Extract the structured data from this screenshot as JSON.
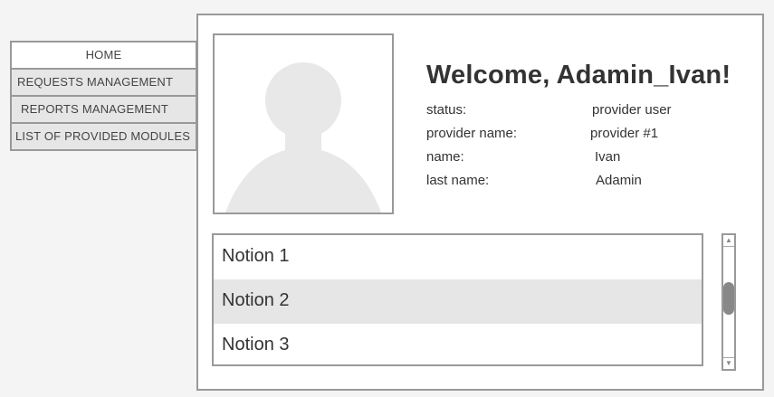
{
  "nav": {
    "items": [
      {
        "label": "HOME",
        "active": true
      },
      {
        "label": "REQUESTS MANAGEMENT",
        "active": false
      },
      {
        "label": "REPORTS MANAGEMENT",
        "active": false
      },
      {
        "label": "LIST OF PROVIDED MODULES",
        "active": false
      }
    ]
  },
  "profile": {
    "welcome": "Welcome, Adamin_Ivan!",
    "fields": [
      {
        "label": "status:",
        "value": "provider user"
      },
      {
        "label": "provider name:",
        "value": "provider #1"
      },
      {
        "label": "name:",
        "value": "Ivan"
      },
      {
        "label": "last name:",
        "value": "Adamin"
      }
    ],
    "avatar_icon": "user-placeholder-icon"
  },
  "notions": {
    "items": [
      "Notion 1",
      "Notion 2",
      "Notion 3"
    ],
    "selected_index": 1
  },
  "scrollbar": {
    "position": 0.45,
    "up_glyph": "▲",
    "down_glyph": "▼"
  },
  "colors": {
    "border": "#999999",
    "selected_bg": "#e6e6e6",
    "page_bg": "#f4f4f4",
    "avatar_fill": "#e8e8e8"
  }
}
